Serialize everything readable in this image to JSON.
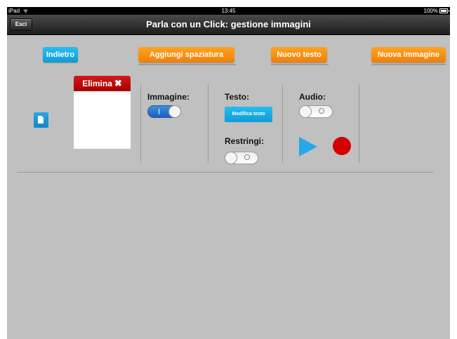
{
  "status_bar": {
    "device": "iPad",
    "time": "13:45",
    "battery": "100%"
  },
  "nav": {
    "back_label": "Esci",
    "title": "Parla con un Click: gestione immagini"
  },
  "toolbar": {
    "back_label": "Indietro",
    "add_spacing_label": "Aggiungi spaziatura",
    "new_text_label": "Nuovo testo",
    "new_image_label": "Nuova immagine"
  },
  "item": {
    "delete_label": "Elimina",
    "image_label": "Immagine:",
    "image_toggle": "on",
    "text_label": "Testo:",
    "edit_text_label": "Modifica testo",
    "shrink_label": "Restringi:",
    "shrink_toggle": "off",
    "audio_label": "Audio:",
    "audio_toggle": "off"
  },
  "colors": {
    "blue": "#1aacea",
    "orange": "#f79214",
    "red": "#c00000",
    "record": "#d40000",
    "background": "#c0c0c0"
  },
  "icons": {
    "doc": "document-icon",
    "delete": "x-icon",
    "play": "play-icon",
    "record": "record-icon"
  }
}
